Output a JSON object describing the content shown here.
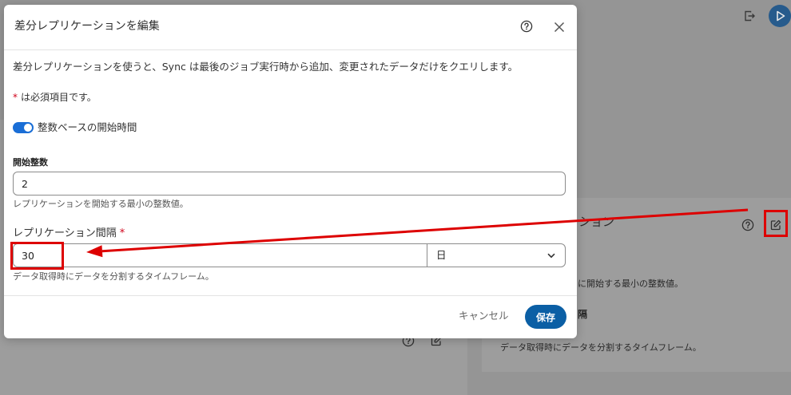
{
  "colors": {
    "page_dimmed": "#959595",
    "card_dimmed": "#9d9d9d",
    "dialog_bg": "#ffffff",
    "text": "#333333",
    "muted_text": "#555555",
    "toggle_on": "#1a6ed6",
    "primary_button": "#0b5fa5",
    "required_asterisk": "#d0021b",
    "annotation_red": "#dd0000",
    "dimmed_run_button": "#275b8c"
  },
  "background": {
    "header_actions": [
      {
        "icon": "export-icon"
      },
      {
        "icon": "play-icon"
      }
    ],
    "replication_card": {
      "title": "ション",
      "help_icon": "help-icon",
      "edit_icon": "edit-icon",
      "start_integer_help": "に開始する最小の整数値。",
      "interval_label": "隔",
      "interval_help": "データ取得時にデータを分割するタイムフレーム。"
    },
    "left_card": {
      "help_icon": "help-icon",
      "edit_icon": "edit-icon"
    }
  },
  "dialog": {
    "title": "差分レプリケーションを編集",
    "help_icon": "help-icon",
    "close_icon": "close-icon",
    "description": "差分レプリケーションを使うと、Sync は最後のジョブ実行時から追加、変更されたデータだけをクエリします。",
    "required_note": {
      "asterisk": "*",
      "text": "は必須項目です。"
    },
    "toggle": {
      "label": "整数ベースの開始時間",
      "on": true
    },
    "start_integer": {
      "label": "開始整数",
      "value": "2",
      "help": "レプリケーションを開始する最小の整数値。"
    },
    "interval": {
      "label": "レプリケーション間隔",
      "asterisk": "*",
      "value": "30",
      "unit": "日",
      "unit_icon": "chevron-down-icon",
      "help": "データ取得時にデータを分割するタイムフレーム。"
    },
    "footer": {
      "cancel": "キャンセル",
      "save": "保存"
    }
  }
}
